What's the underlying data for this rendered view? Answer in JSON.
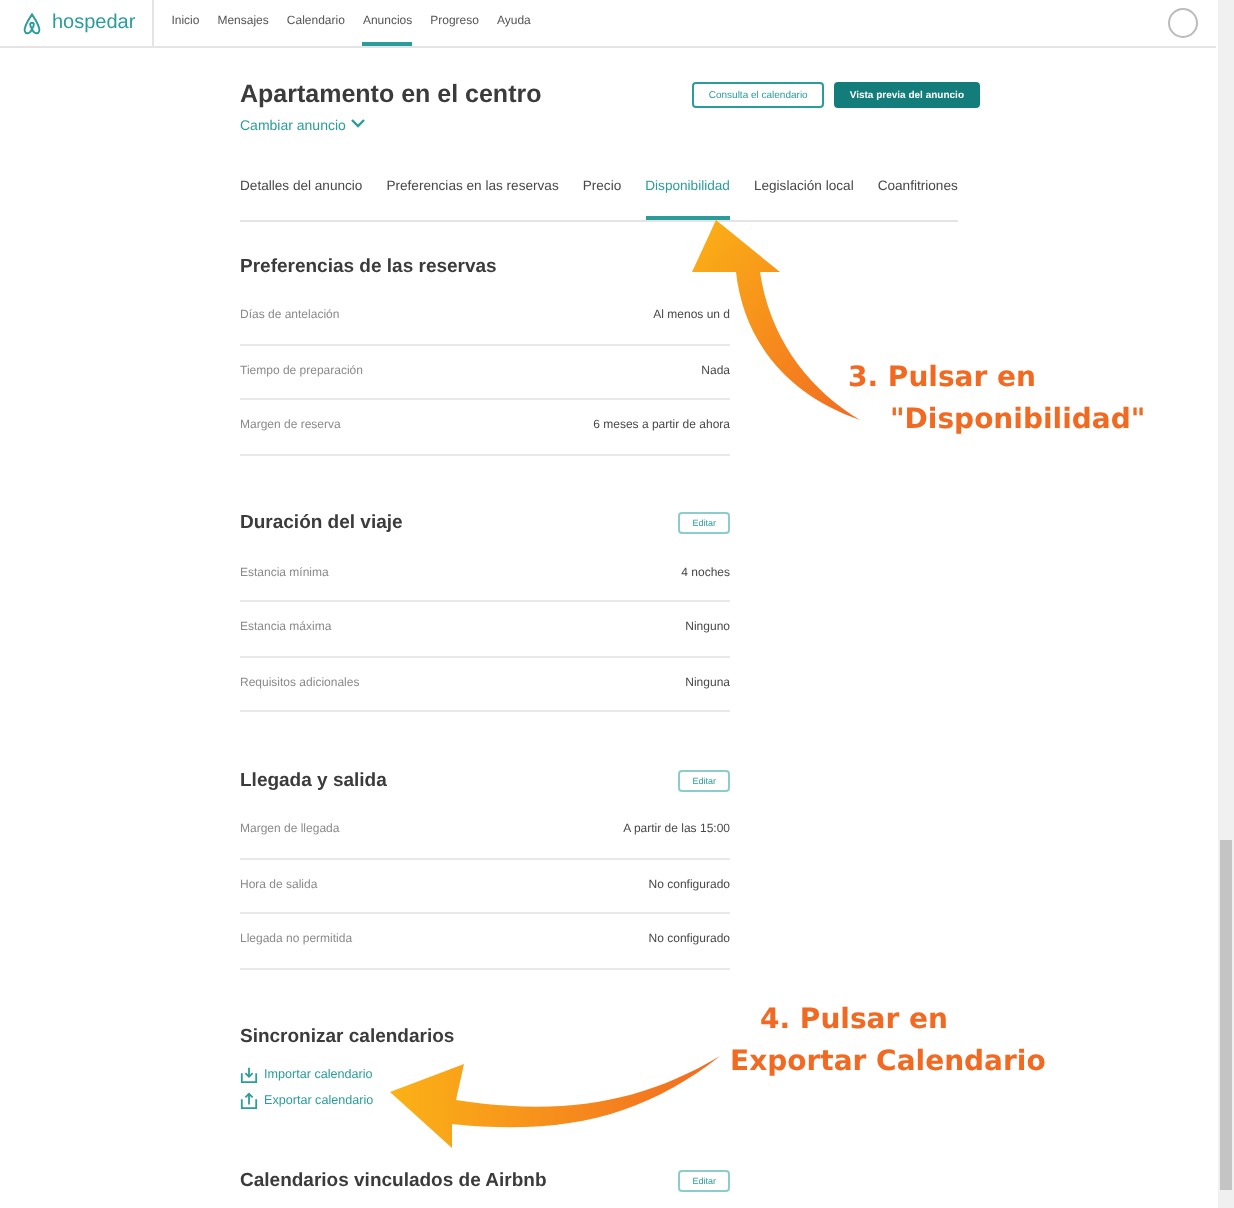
{
  "navbar": {
    "brand": "hospedar",
    "items": [
      {
        "label": "Inicio",
        "selected": false
      },
      {
        "label": "Mensajes",
        "selected": false
      },
      {
        "label": "Calendario",
        "selected": false
      },
      {
        "label": "Anuncios",
        "selected": true
      },
      {
        "label": "Progreso",
        "selected": false
      },
      {
        "label": "Ayuda",
        "selected": false
      }
    ]
  },
  "listing": {
    "title": "Apartamento en el centro",
    "change_link": "Cambiar anuncio",
    "buttons": [
      {
        "label": "Consulta el calendario",
        "kind": "outline"
      },
      {
        "label": "Vista previa del anuncio",
        "kind": "primary"
      }
    ]
  },
  "tabs": [
    {
      "label": "Detalles del anuncio",
      "selected": false
    },
    {
      "label": "Preferencias en las reservas",
      "selected": false
    },
    {
      "label": "Precio",
      "selected": false
    },
    {
      "label": "Disponibilidad",
      "selected": true
    },
    {
      "label": "Legislación local",
      "selected": false
    },
    {
      "label": "Coanfitriones",
      "selected": false
    }
  ],
  "sections": [
    {
      "kind": "rows",
      "title": "Preferencias de las reservas",
      "rows": [
        {
          "label": "Días de antelación",
          "value": "Al menos un d"
        },
        {
          "label": "Tiempo de preparación",
          "value": "Nada"
        },
        {
          "label": "Margen de reserva",
          "value": "6 meses a partir de ahora"
        }
      ]
    },
    {
      "kind": "rows",
      "title": "Duración del viaje",
      "edit": "Editar",
      "rows": [
        {
          "label": "Estancia mínima",
          "value": "4 noches"
        },
        {
          "label": "Estancia máxima",
          "value": "Ninguno"
        },
        {
          "label": "Requisitos adicionales",
          "value": "Ninguna"
        }
      ]
    },
    {
      "kind": "rows",
      "title": "Llegada y salida",
      "edit": "Editar",
      "rows": [
        {
          "label": "Margen de llegada",
          "value": "A partir de las 15:00"
        },
        {
          "label": "Hora de salida",
          "value": "No configurado"
        },
        {
          "label": "Llegada no permitida",
          "value": "No configurado"
        }
      ]
    },
    {
      "kind": "links",
      "title": "Sincronizar calendarios",
      "links": [
        {
          "label": "Importar calendario",
          "kind": "import"
        },
        {
          "label": "Exportar calendario",
          "kind": "export"
        }
      ]
    },
    {
      "kind": "rows",
      "title": "Calendarios vinculados de Airbnb",
      "edit": "Editar"
    }
  ],
  "annotations": [
    {
      "lines": [
        "3. Pulsar en",
        "\"Disponibilidad\""
      ]
    },
    {
      "lines": [
        "4. Pulsar en",
        "Exportar Calendario"
      ]
    }
  ]
}
